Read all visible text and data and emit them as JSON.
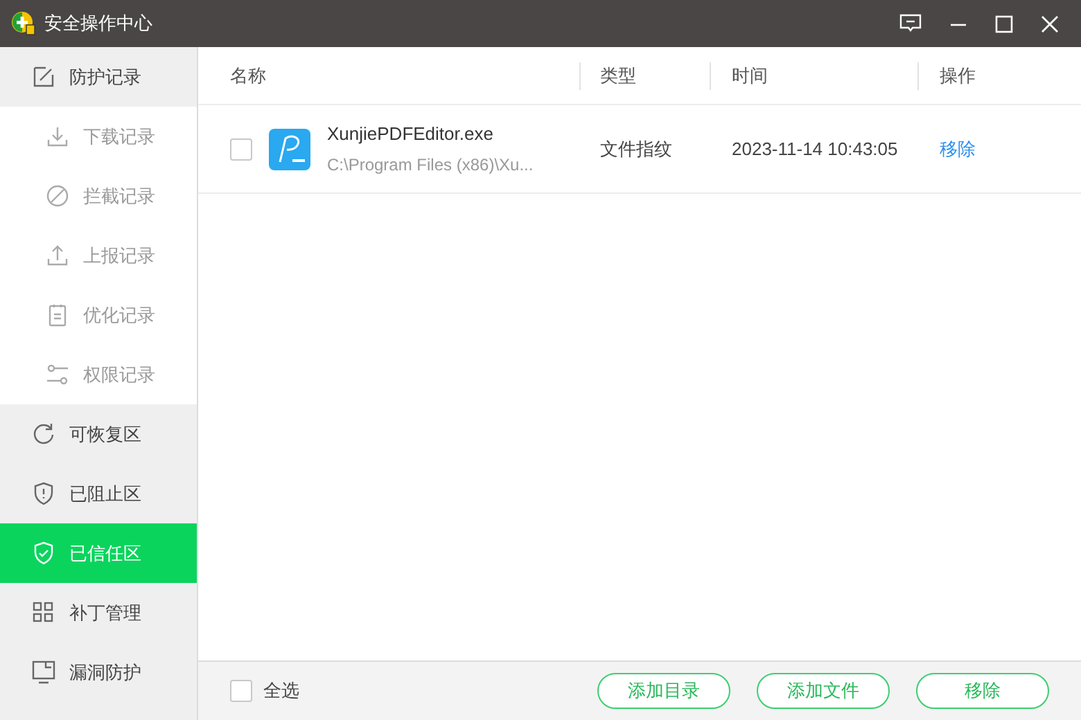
{
  "window": {
    "title": "安全操作中心"
  },
  "sidebar": {
    "items": [
      {
        "label": "防护记录",
        "selected": false,
        "expanded": true,
        "children": [
          {
            "label": "下载记录",
            "selected": false
          },
          {
            "label": "拦截记录",
            "selected": false
          },
          {
            "label": "上报记录",
            "selected": false
          },
          {
            "label": "优化记录",
            "selected": false
          },
          {
            "label": "权限记录",
            "selected": false
          }
        ]
      },
      {
        "label": "可恢复区",
        "selected": false
      },
      {
        "label": "已阻止区",
        "selected": false
      },
      {
        "label": "已信任区",
        "selected": true
      },
      {
        "label": "补丁管理",
        "selected": false
      },
      {
        "label": "漏洞防护",
        "selected": false
      }
    ]
  },
  "table": {
    "columns": [
      "名称",
      "类型",
      "时间",
      "操作"
    ],
    "rows": [
      {
        "checked": false,
        "name": "XunjiePDFEditor.exe",
        "path": "C:\\Program Files (x86)\\Xu...",
        "type": "文件指纹",
        "time": "2023-11-14 10:43:05",
        "action": "移除"
      }
    ]
  },
  "footer": {
    "select_all": {
      "label": "全选",
      "checked": false
    },
    "buttons": [
      "添加目录",
      "添加文件",
      "移除"
    ]
  }
}
